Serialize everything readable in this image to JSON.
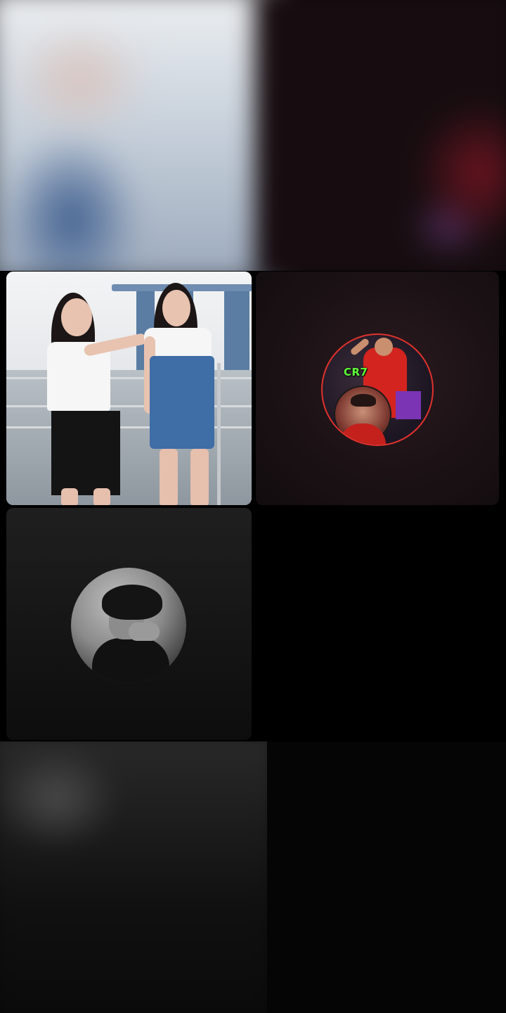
{
  "screen": {
    "type": "group-video-call-grid"
  },
  "participants": [
    {
      "slot": "top-left-background",
      "camera": "on"
    },
    {
      "slot": "top-right-background",
      "camera": "off"
    },
    {
      "slot": "tile-1",
      "camera": "on"
    },
    {
      "slot": "tile-2",
      "camera": "off",
      "avatar_text": "CR7"
    },
    {
      "slot": "tile-3",
      "camera": "off"
    },
    {
      "slot": "bottom-background",
      "camera": "on"
    }
  ],
  "colors": {
    "background": "#000000",
    "avatar_ring": "#e0322c",
    "cr7_text": "#5eff3a"
  }
}
